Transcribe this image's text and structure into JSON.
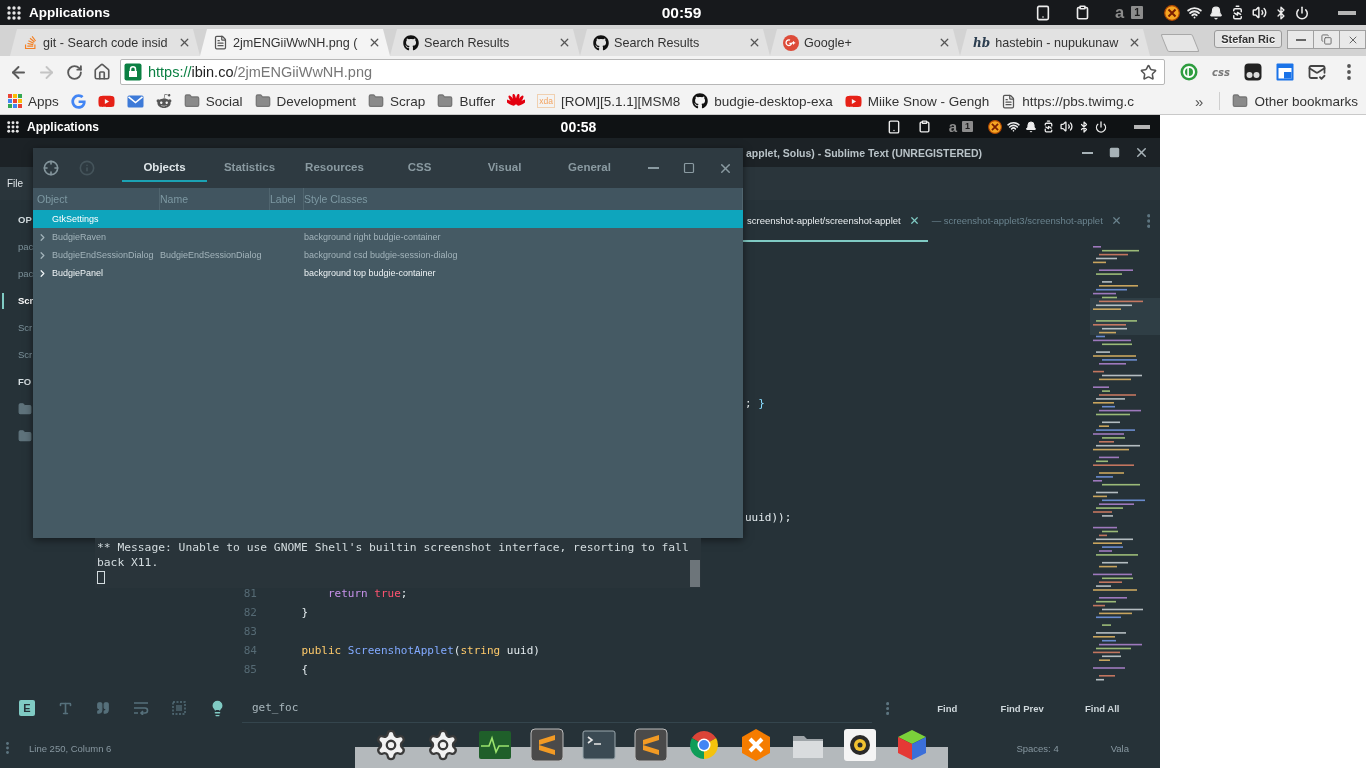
{
  "top_bar": {
    "menu": "Applications",
    "clock": "00:59",
    "indicators": [
      "a",
      "1"
    ]
  },
  "browser": {
    "tabs": [
      {
        "title": "git - Search code insid",
        "selected": false
      },
      {
        "title": "2jmENGiiWwNH.png (",
        "selected": true
      },
      {
        "title": "Search Results",
        "selected": false
      },
      {
        "title": "Search Results",
        "selected": false
      },
      {
        "title": "Google+",
        "selected": false
      },
      {
        "title": "hastebin - nupukunaw",
        "icon_text": "hb",
        "selected": false
      }
    ],
    "profile": "Stefan Ric",
    "nav": {
      "back_disabled": false,
      "forward_disabled": true
    },
    "url": {
      "scheme": "https://",
      "host": "ibin.co",
      "path": "/2jmENGiiWwNH.png"
    },
    "extensions": [
      {
        "kind": "icon"
      },
      {
        "kind": "text",
        "label": "css"
      },
      {
        "kind": "icon"
      },
      {
        "kind": "icon"
      },
      {
        "kind": "icon"
      }
    ],
    "bookmarks": [
      {
        "kind": "link",
        "label": "Apps"
      },
      {
        "kind": "link"
      },
      {
        "kind": "link"
      },
      {
        "kind": "link"
      },
      {
        "kind": "link"
      },
      {
        "kind": "folder",
        "label": "Social"
      },
      {
        "kind": "folder",
        "label": "Development"
      },
      {
        "kind": "folder",
        "label": "Scrap"
      },
      {
        "kind": "folder",
        "label": "Buffer"
      },
      {
        "kind": "link"
      },
      {
        "kind": "link",
        "icon_text": "xda",
        "label": "[ROM][5.1.1][MSM8"
      },
      {
        "kind": "link",
        "label": "budgie-desktop-exa"
      },
      {
        "kind": "link",
        "label": "Miike Snow - Gengh"
      },
      {
        "kind": "link",
        "label": "https://pbs.twimg.c"
      }
    ],
    "overflow": "»",
    "other_bookmarks": "Other bookmarks"
  },
  "screenshot": {
    "top_bar": {
      "menu": "Applications",
      "clock": "00:58",
      "indicators": [
        "a",
        "1"
      ]
    },
    "editor": {
      "title": "applet, Solus) - Sublime Text (UNREGISTERED)",
      "menu": [
        "File"
      ],
      "sidebar": [
        {
          "kind": "header",
          "label": "OP",
          "selected": false
        },
        {
          "kind": "file",
          "label": "pac",
          "selected": false
        },
        {
          "kind": "file",
          "label": "pac",
          "selected": false
        },
        {
          "kind": "file",
          "label": "Scr",
          "selected": true
        },
        {
          "kind": "file",
          "label": "Scr",
          "selected": false
        },
        {
          "kind": "file",
          "label": "Scr",
          "selected": false
        },
        {
          "kind": "header",
          "label": "FO",
          "selected": false
        },
        {
          "kind": "folder",
          "selected": false
        },
        {
          "kind": "folder",
          "selected": false
        }
      ],
      "tabs": [
        {
          "title": "screenshot-applet/screenshot-applet",
          "selected": true
        },
        {
          "title": "— screenshot-applet3/screenshot-applet",
          "selected": false
        }
      ],
      "code": {
        "tails": [
          {
            "tokens": [
              {
                "text": "; ",
                "kind": "plain"
              },
              {
                "text": "}",
                "kind": "punct"
              }
            ]
          },
          {
            "tokens": [
              {
                "text": "uuid));",
                "kind": "plain"
              }
            ]
          }
        ],
        "lines": [
          {
            "number": "81",
            "tokens": [
              {
                "text": "        return",
                "kind": "keyword"
              },
              {
                "text": " true",
                "kind": "literal"
              },
              {
                "text": ";",
                "kind": "plain"
              }
            ]
          },
          {
            "number": "82",
            "tokens": [
              {
                "text": "    }",
                "kind": "plain"
              }
            ]
          },
          {
            "number": "83"
          },
          {
            "number": "84",
            "tokens": [
              {
                "text": "    public",
                "kind": "storage"
              },
              {
                "text": " ScreenshotApplet",
                "kind": "function"
              },
              {
                "text": "(",
                "kind": "plain"
              },
              {
                "text": "string",
                "kind": "type"
              },
              {
                "text": " uuid)",
                "kind": "plain"
              }
            ]
          },
          {
            "number": "85",
            "tokens": [
              {
                "text": "    {",
                "kind": "plain"
              }
            ]
          }
        ]
      },
      "find": {
        "toggles": [
          {
            "kind": "text",
            "label": "E",
            "on": true
          },
          {
            "kind": "icon",
            "on": false
          },
          {
            "kind": "icon",
            "on": false
          },
          {
            "kind": "icon",
            "on": false
          },
          {
            "kind": "icon",
            "on": false
          },
          {
            "kind": "icon",
            "on": true
          }
        ],
        "query": "get_foc",
        "buttons": [
          "Find",
          "Find Prev",
          "Find All"
        ]
      },
      "status": {
        "left": "Line 250, Column 6",
        "right": [
          "Spaces: 4",
          "Vala"
        ]
      }
    },
    "inspector": {
      "header_buttons": [
        {
          "disabled": false
        },
        {
          "disabled": true
        }
      ],
      "tabs": [
        {
          "label": "Objects",
          "selected": true
        },
        {
          "label": "Statistics",
          "selected": false
        },
        {
          "label": "Resources",
          "selected": false
        },
        {
          "label": "CSS",
          "selected": false
        },
        {
          "label": "Visual",
          "selected": false
        },
        {
          "label": "General",
          "selected": false
        }
      ],
      "columns": [
        "Object",
        "Name",
        "Label",
        "Style Classes"
      ],
      "rows": [
        {
          "object": "GtkSettings",
          "expandable": false,
          "dimmed": false,
          "selected": true
        },
        {
          "object": "BudgieRaven",
          "style_classes": "background right budgie-container",
          "expandable": true,
          "dimmed": true,
          "selected": false
        },
        {
          "object": "BudgieEndSessionDialog",
          "name": "BudgieEndSessionDialog",
          "style_classes": "background csd budgie-session-dialog",
          "expandable": true,
          "dimmed": true,
          "selected": false
        },
        {
          "object": "BudgiePanel",
          "style_classes": "background top budgie-container",
          "expandable": true,
          "dimmed": false,
          "selected": false
        }
      ]
    },
    "terminal": {
      "message": "** Message: Unable to use GNOME Shell's builtin screenshot interface, resorting to fall back X11."
    }
  }
}
